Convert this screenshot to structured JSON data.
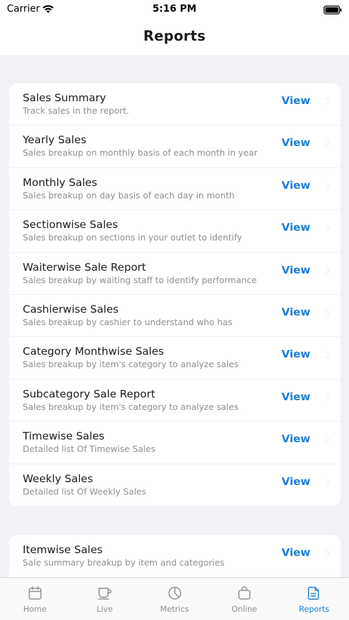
{
  "status_bar": {
    "carrier": "Carrier",
    "time": "5:16 PM"
  },
  "header": {
    "title": "Reports"
  },
  "sections": [
    {
      "items": [
        {
          "title": "Sales Summary",
          "subtitle": "Track sales in the report.",
          "action": "View"
        },
        {
          "title": "Yearly Sales",
          "subtitle": "Sales breakup on monthly basis of each month in year",
          "action": "View"
        },
        {
          "title": "Monthly Sales",
          "subtitle": "Sales breakup on day basis of each day in month",
          "action": "View"
        },
        {
          "title": "Sectionwise Sales",
          "subtitle": "Sales breakup on sections in your outlet to identify",
          "action": "View"
        },
        {
          "title": "Waiterwise Sale Report",
          "subtitle": "Sales breakup by waiting staff to identify performance",
          "action": "View"
        },
        {
          "title": "Cashierwise Sales",
          "subtitle": "Sales breakup by cashier to understand who has",
          "action": "View"
        },
        {
          "title": "Category Monthwise Sales",
          "subtitle": "Sales breakup by item's category to analyze sales",
          "action": "View"
        },
        {
          "title": "Subcategory Sale Report",
          "subtitle": "Sales breakup by item's category to analyze sales",
          "action": "View"
        },
        {
          "title": "Timewise Sales",
          "subtitle": "Detailed list Of Timewise Sales",
          "action": "View"
        },
        {
          "title": "Weekly Sales",
          "subtitle": "Detailed list Of Weekly Sales",
          "action": "View"
        }
      ]
    },
    {
      "items": [
        {
          "title": "Itemwise Sales",
          "subtitle": "Sale summary breakup by item and categories",
          "action": "View"
        }
      ]
    }
  ],
  "tab_bar": {
    "tabs": [
      {
        "label": "Home",
        "icon": "calendar-icon",
        "active": false
      },
      {
        "label": "Live",
        "icon": "cup-icon",
        "active": false
      },
      {
        "label": "Metrics",
        "icon": "pie-chart-icon",
        "active": false
      },
      {
        "label": "Online",
        "icon": "bag-icon",
        "active": false
      },
      {
        "label": "Reports",
        "icon": "document-icon",
        "active": true
      }
    ]
  },
  "colors": {
    "accent": "#1a7fd8",
    "background": "#f2f2f6",
    "card": "#ffffff",
    "muted": "#8e8e93"
  }
}
